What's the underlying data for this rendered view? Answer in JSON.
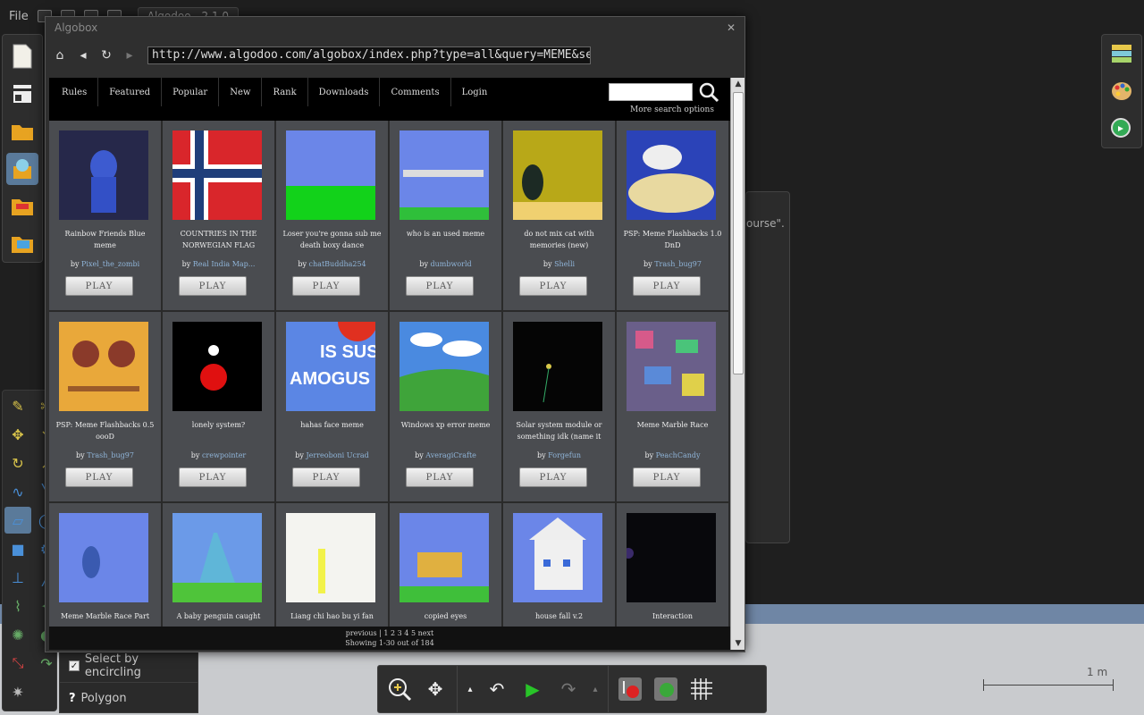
{
  "app": {
    "menu_file": "File",
    "doc_tab": "Algodoo - 2.1.0"
  },
  "browser": {
    "window_title": "Algobox",
    "url": "http://www.algodoo.com/algobox/index.php?type=all&query=MEME&selected=0",
    "nav": [
      "Rules",
      "Featured",
      "Popular",
      "New",
      "Rank",
      "Downloads",
      "Comments",
      "Login"
    ],
    "more_search": "More search options",
    "play_label": "PLAY",
    "by_label": "by",
    "pager_line1": "previous | 1  2  3  4  5  next",
    "pager_line2": "Showing 1-30 out of 184",
    "tiles": [
      {
        "title": "Rainbow Friends Blue meme",
        "author": "Pixel_the_zombi"
      },
      {
        "title": "COUNTRIES IN THE NORWEGIAN FLAG",
        "author": "Real India Map..."
      },
      {
        "title": "Loser you're gonna sub me death boxy dance",
        "author": "chatBuddha254"
      },
      {
        "title": "who is an used meme",
        "author": "dumbworld"
      },
      {
        "title": "do not mix cat with memories (new)",
        "author": "Shelli"
      },
      {
        "title": "PSP: Meme Flashbacks 1.0 DnD",
        "author": "Trash_bug97"
      },
      {
        "title": "PSP: Meme Flashbacks 0.5 oooD",
        "author": "Trash_bug97"
      },
      {
        "title": "lonely system?",
        "author": "crewpointer"
      },
      {
        "title": "hahas face meme",
        "author": "Jerreoboni Ucrad"
      },
      {
        "title": "Windows xp error meme",
        "author": "AveragiCrafte"
      },
      {
        "title": "Solar system module or something idk (name it",
        "author": "Forgefun"
      },
      {
        "title": "Meme Marble Race",
        "author": "PeachCandy"
      },
      {
        "title": "Meme Marble Race Part",
        "author": ""
      },
      {
        "title": "A baby penguin caught",
        "author": ""
      },
      {
        "title": "Liang chi hao bu yi fan",
        "author": ""
      },
      {
        "title": "copied eyes",
        "author": ""
      },
      {
        "title": "house fall v.2",
        "author": ""
      },
      {
        "title": "Interaction",
        "author": ""
      }
    ]
  },
  "right_panel": {
    "partial_text": "ourse\"."
  },
  "options": {
    "select_label": "Select by encircling",
    "polygon_label": "Polygon",
    "polygon_key": "?"
  },
  "scale": {
    "label": "1 m"
  },
  "colors": {
    "accent_selected": "#5a7a9a",
    "ground": "#c9cbce",
    "ground_band": "#6f86a5",
    "link": "#8fb4d8"
  }
}
